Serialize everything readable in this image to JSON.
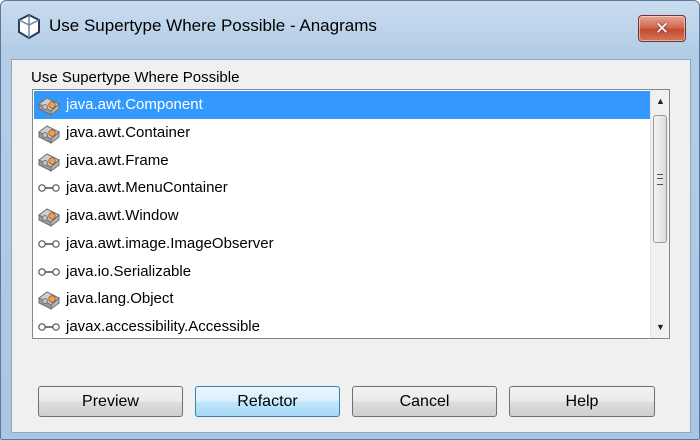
{
  "window": {
    "title": "Use Supertype Where Possible - Anagrams",
    "close_icon": "close-icon"
  },
  "dialog": {
    "list_label": "Use Supertype Where Possible",
    "items": [
      {
        "label": "java.awt.Component",
        "icon": "class-icon",
        "selected": true
      },
      {
        "label": "java.awt.Container",
        "icon": "class-icon",
        "selected": false
      },
      {
        "label": "java.awt.Frame",
        "icon": "class-icon",
        "selected": false
      },
      {
        "label": "java.awt.MenuContainer",
        "icon": "interface-icon",
        "selected": false
      },
      {
        "label": "java.awt.Window",
        "icon": "class-icon",
        "selected": false
      },
      {
        "label": "java.awt.image.ImageObserver",
        "icon": "interface-icon",
        "selected": false
      },
      {
        "label": "java.io.Serializable",
        "icon": "interface-icon",
        "selected": false
      },
      {
        "label": "java.lang.Object",
        "icon": "class-icon",
        "selected": false
      },
      {
        "label": "javax.accessibility.Accessible",
        "icon": "interface-icon",
        "selected": false
      }
    ]
  },
  "buttons": {
    "preview": "Preview",
    "refactor": "Refactor",
    "cancel": "Cancel",
    "help": "Help"
  },
  "colors": {
    "selection": "#3399ff",
    "title_bar": "#b9d1ea"
  }
}
